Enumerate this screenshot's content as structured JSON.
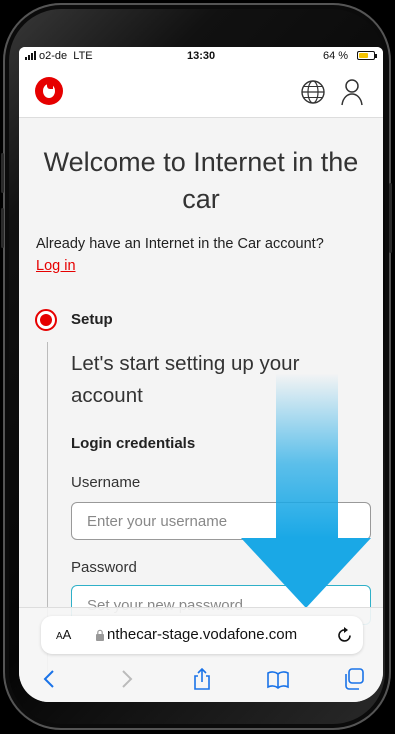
{
  "status_bar": {
    "carrier": "o2-de",
    "network": "LTE",
    "time": "13:30",
    "battery": "64 %",
    "battery_level": 0.64
  },
  "header": {
    "logo": "vodafone-logo-icon",
    "language_icon": "globe-icon",
    "account_icon": "user-icon",
    "brand_color": "#e60000"
  },
  "main": {
    "title": "Welcome to Internet in the car",
    "account_prompt": "Already have an Internet in the Car account?",
    "login_link": "Log in",
    "step": {
      "label": "Setup",
      "heading": "Let's start setting up your account"
    },
    "credentials": {
      "heading": "Login credentials",
      "username_label": "Username",
      "username_placeholder": "Enter your username",
      "username_value": "",
      "password_label": "Password",
      "password_placeholder": "Set your new password",
      "password_value": ""
    }
  },
  "browser": {
    "text_size": "AA",
    "url": "nthecar-stage.vodafone.com",
    "icons": [
      "lock-icon",
      "reload-icon",
      "back-icon",
      "forward-icon",
      "share-icon",
      "bookmarks-icon",
      "tabs-icon"
    ]
  },
  "annotation": {
    "arrow_icon": "scroll-down-arrow-icon",
    "arrow_color": "#1aa8e6"
  }
}
